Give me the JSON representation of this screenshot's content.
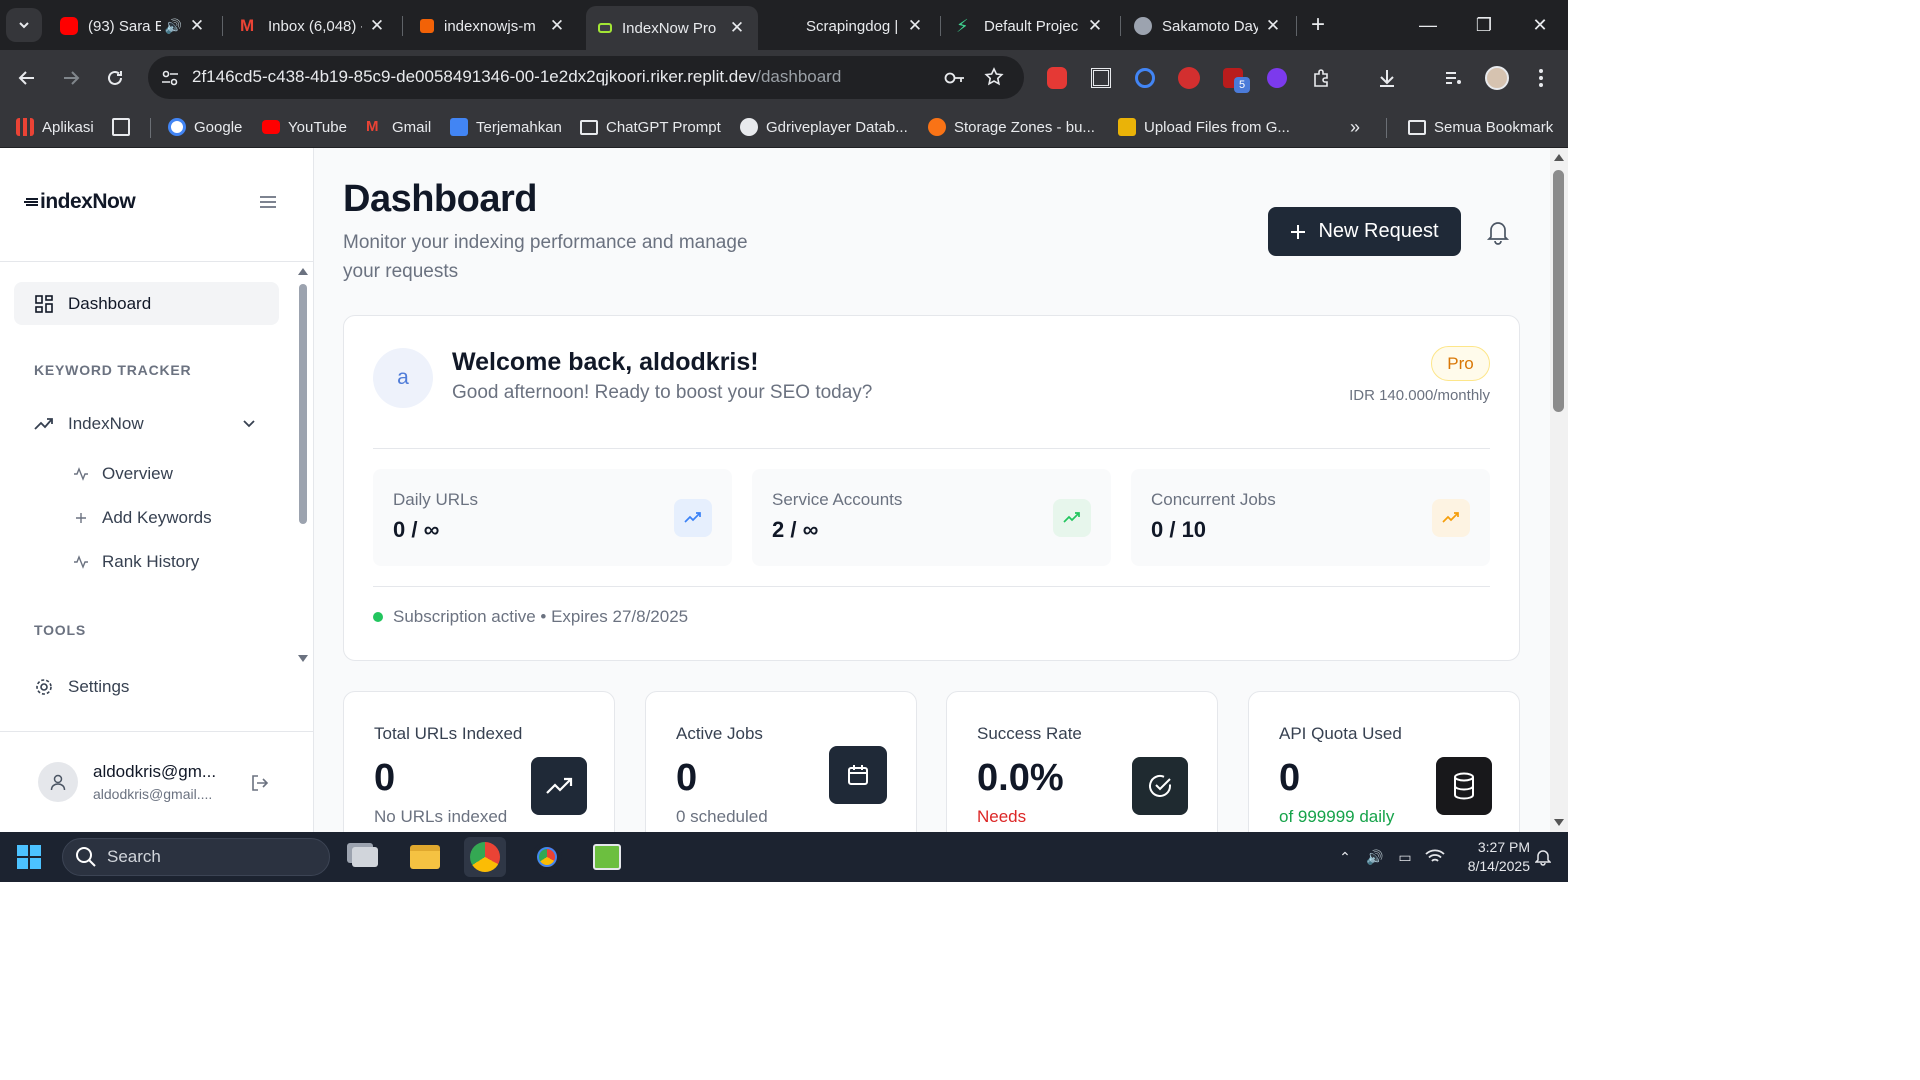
{
  "browser": {
    "tabs": [
      {
        "title": "(93) Sara E",
        "favicon_color": "#ff0000"
      },
      {
        "title": "Inbox (6,048) -",
        "favicon_color": "#ea4335"
      },
      {
        "title": "indexnowjs-m",
        "favicon_color": "#f26207"
      },
      {
        "title": "IndexNow Pro",
        "favicon_color": "#a3e635",
        "active": true
      },
      {
        "title": "Scrapingdog |",
        "favicon_color": "#202124"
      },
      {
        "title": "Default Projec",
        "favicon_color": "#3ecf8e"
      },
      {
        "title": "Sakamoto Day",
        "favicon_color": "#9ca3af"
      }
    ],
    "url_main": "2f146cd5-c438-4b19-85c9-de0058491346-00-1e2dx2qjkoori.riker.replit.dev",
    "url_path": "/dashboard",
    "extension_badge": "5",
    "bookmarks": [
      {
        "label": "Aplikasi"
      },
      {
        "label": "Google"
      },
      {
        "label": "YouTube"
      },
      {
        "label": "Gmail"
      },
      {
        "label": "Terjemahkan"
      },
      {
        "label": "ChatGPT Prompt"
      },
      {
        "label": "Gdriveplayer Datab..."
      },
      {
        "label": "Storage Zones - bu..."
      },
      {
        "label": "Upload Files from G..."
      }
    ],
    "all_bookmarks": "Semua Bookmark"
  },
  "sidebar": {
    "logo": "indexNow",
    "dashboard": "Dashboard",
    "section_keyword": "KEYWORD TRACKER",
    "indexnow": "IndexNow",
    "overview": "Overview",
    "add_keywords": "Add Keywords",
    "rank_history": "Rank History",
    "section_tools": "TOOLS",
    "settings": "Settings",
    "user_name": "aldodkris@gm...",
    "user_email": "aldodkris@gmail...."
  },
  "header": {
    "title": "Dashboard",
    "subtitle": "Monitor your indexing performance and manage your requests",
    "new_request": "New Request"
  },
  "welcome": {
    "avatar_letter": "a",
    "title": "Welcome back, aldodkris!",
    "subtitle": "Good afternoon! Ready to boost your SEO today?",
    "plan": "Pro",
    "price": "IDR 140.000/monthly",
    "mini_stats": [
      {
        "label": "Daily URLs",
        "value": "0 / ∞",
        "icon": "trending-up-icon",
        "color": "#3b82f6"
      },
      {
        "label": "Service Accounts",
        "value": "2 / ∞",
        "icon": "trending-up-icon",
        "color": "#22c55e"
      },
      {
        "label": "Concurrent Jobs",
        "value": "0 / 10",
        "icon": "trending-up-icon",
        "color": "#f59e0b"
      }
    ],
    "subscription": "Subscription active • Expires 27/8/2025"
  },
  "stats": [
    {
      "label": "Total URLs Indexed",
      "value": "0",
      "sub": "No URLs indexed",
      "sub_color": "#6b7280",
      "icon": "trending-up-icon"
    },
    {
      "label": "Active Jobs",
      "value": "0",
      "sub": "0 scheduled",
      "sub_color": "#6b7280",
      "icon": "calendar-icon"
    },
    {
      "label": "Success Rate",
      "value": "0.0%",
      "sub": "Needs",
      "sub_color": "#dc2626",
      "icon": "check-circle-icon"
    },
    {
      "label": "API Quota Used",
      "value": "0",
      "sub": "of 999999 daily",
      "sub_color": "#16a34a",
      "icon": "database-icon"
    }
  ],
  "taskbar": {
    "search": "Search",
    "time": "3:27 PM",
    "date": "8/14/2025"
  }
}
